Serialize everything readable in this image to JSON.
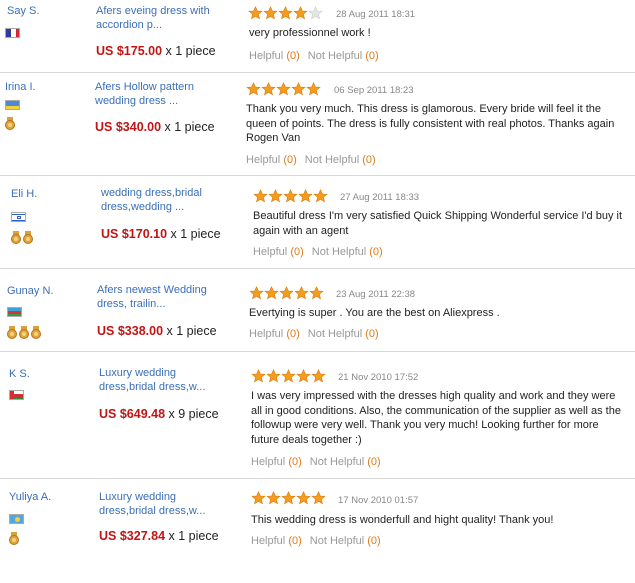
{
  "helpful_label": "Helpful",
  "not_helpful_label": "Not Helpful",
  "colors": {
    "price": "#c21414",
    "link": "#3b6fb6",
    "star": "#f39c1f",
    "count": "#e07b1a"
  },
  "reviews": [
    {
      "buyer": "Say S.",
      "flag": "france-flag",
      "medals": 0,
      "product": "Afers eveing dress with accordion p...",
      "price": "US $175.00",
      "qty": "x 1 piece",
      "rating": 4,
      "date": "28 Aug 2011 18:31",
      "comment": "very professionnel work !",
      "helpful": "(0)",
      "not_helpful": "(0)"
    },
    {
      "buyer": "Irina I.",
      "flag": "ukraine-flag",
      "medals": 1,
      "product": "Afers Hollow pattern wedding dress ...",
      "price": "US $340.00",
      "qty": "x 1 piece",
      "rating": 5,
      "date": "06 Sep 2011 18:23",
      "comment": "Thank you very much. This dress is glamorous. Every bride will feel it the queen of points. The dress is fully consistent with real photos. Thanks again Rogen Van",
      "helpful": "(0)",
      "not_helpful": "(0)"
    },
    {
      "buyer": "Eli H.",
      "flag": "israel-flag",
      "medals": 2,
      "product": "wedding dress,bridal dress,wedding ...",
      "price": "US $170.10",
      "qty": "x 1 piece",
      "rating": 5,
      "date": "27 Aug 2011 18:33",
      "comment": "Beautiful dress I'm very satisfied Quick Shipping Wonderful service I'd buy it again with an agent",
      "helpful": "(0)",
      "not_helpful": "(0)"
    },
    {
      "buyer": "Gunay N.",
      "flag": "azerbaijan-flag",
      "medals": 3,
      "product": "Afers newest Wedding dress, trailin...",
      "price": "US $338.00",
      "qty": "x 1 piece",
      "rating": 5,
      "date": "23 Aug 2011 22:38",
      "comment": "Evertying is super . You are the best on Aliexpress .",
      "helpful": "(0)",
      "not_helpful": "(0)"
    },
    {
      "buyer": "K S.",
      "flag": "oman-flag",
      "medals": 0,
      "product": "Luxury wedding dress,bridal dress,w...",
      "price": "US $649.48",
      "qty": "x 9 piece",
      "rating": 5,
      "date": "21 Nov 2010 17:52",
      "comment": "I was very impressed with the dresses high quality and work and they were all in good conditions. Also, the communication of the supplier as well as the followup were very well. Thank you very much! Looking further for more future deals together :)",
      "helpful": "(0)",
      "not_helpful": "(0)"
    },
    {
      "buyer": "Yuliya A.",
      "flag": "kazakhstan-flag",
      "medals": 1,
      "product": "Luxury wedding dress,bridal dress,w...",
      "price": "US $327.84",
      "qty": "x 1 piece",
      "rating": 5,
      "date": "17 Nov 2010 01:57",
      "comment": "This wedding dress is wonderfull and hight quality! Thank you!",
      "helpful": "(0)",
      "not_helpful": "(0)"
    }
  ]
}
